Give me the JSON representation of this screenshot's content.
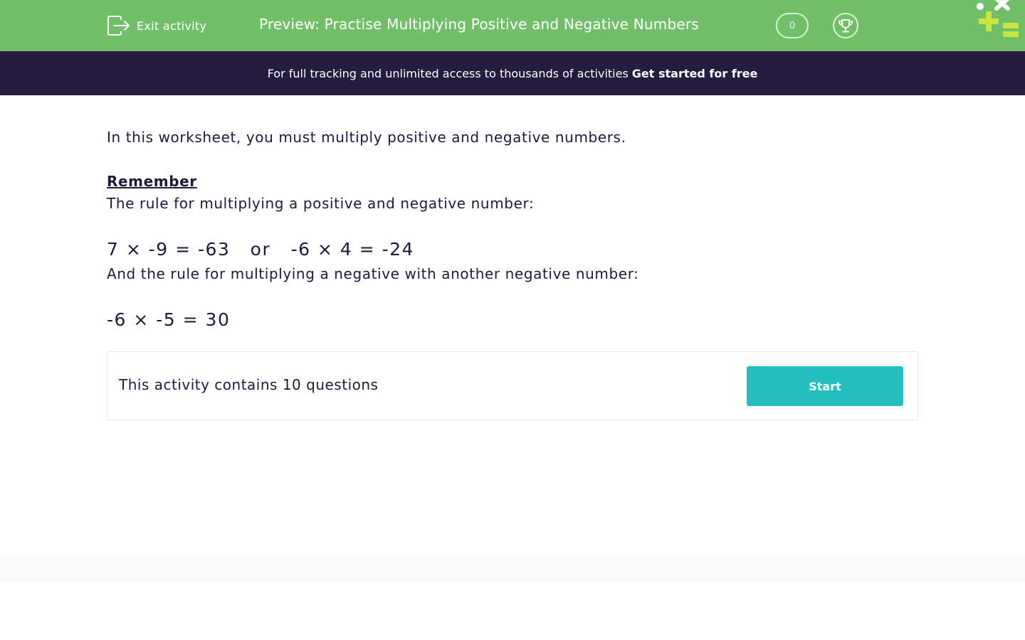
{
  "header": {
    "exit_label": "Exit activity",
    "title": "Preview: Practise Multiplying Positive and Negative Numbers",
    "score": "0",
    "colors": {
      "bar": "#72bf6a",
      "logo_cross": "#ffffff",
      "logo_plus": "#c8e642",
      "logo_equals": "#c8e642"
    }
  },
  "banner": {
    "text": "For full tracking and unlimited access to thousands of activities",
    "cta": "Get started for free"
  },
  "content": {
    "intro": "In this worksheet, you must multiply positive and negative numbers.",
    "remember_heading": "Remember",
    "rule1": "The rule for multiplying a positive and negative number:",
    "example1": "7 × -9 = -63   or   -6 × 4 = -24",
    "rule2": "And the rule for multiplying a negative with another negative number:",
    "example2": "-6 × -5 = 30"
  },
  "card": {
    "text": "This activity contains 10 questions",
    "start_label": "Start"
  }
}
